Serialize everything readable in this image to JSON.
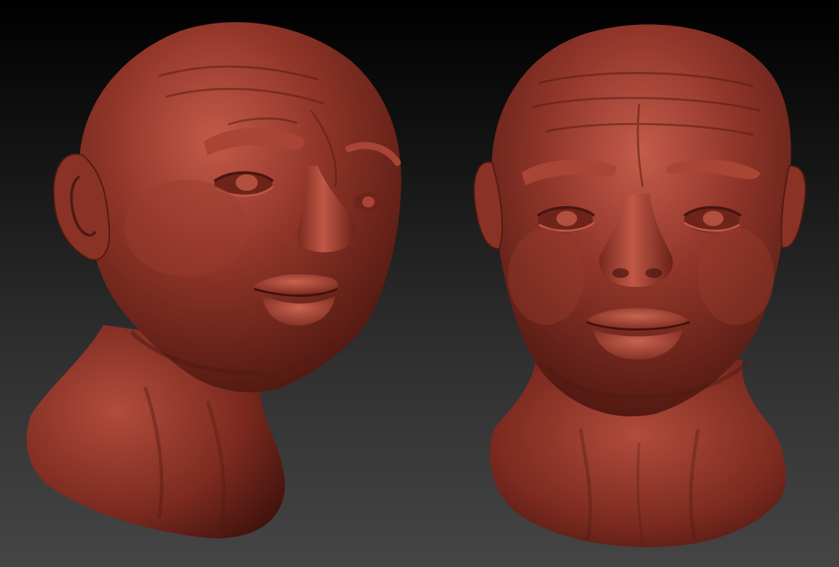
{
  "scene": {
    "background_top": "#000000",
    "background_bottom": "#454545",
    "material_color": "#8a3226",
    "material_highlight": "#c25a48",
    "material_shadow": "#3e120c",
    "subjects": [
      {
        "name": "sculpted-head-three-quarter-view",
        "view": "three-quarter"
      },
      {
        "name": "sculpted-head-front-view",
        "view": "front"
      }
    ]
  }
}
